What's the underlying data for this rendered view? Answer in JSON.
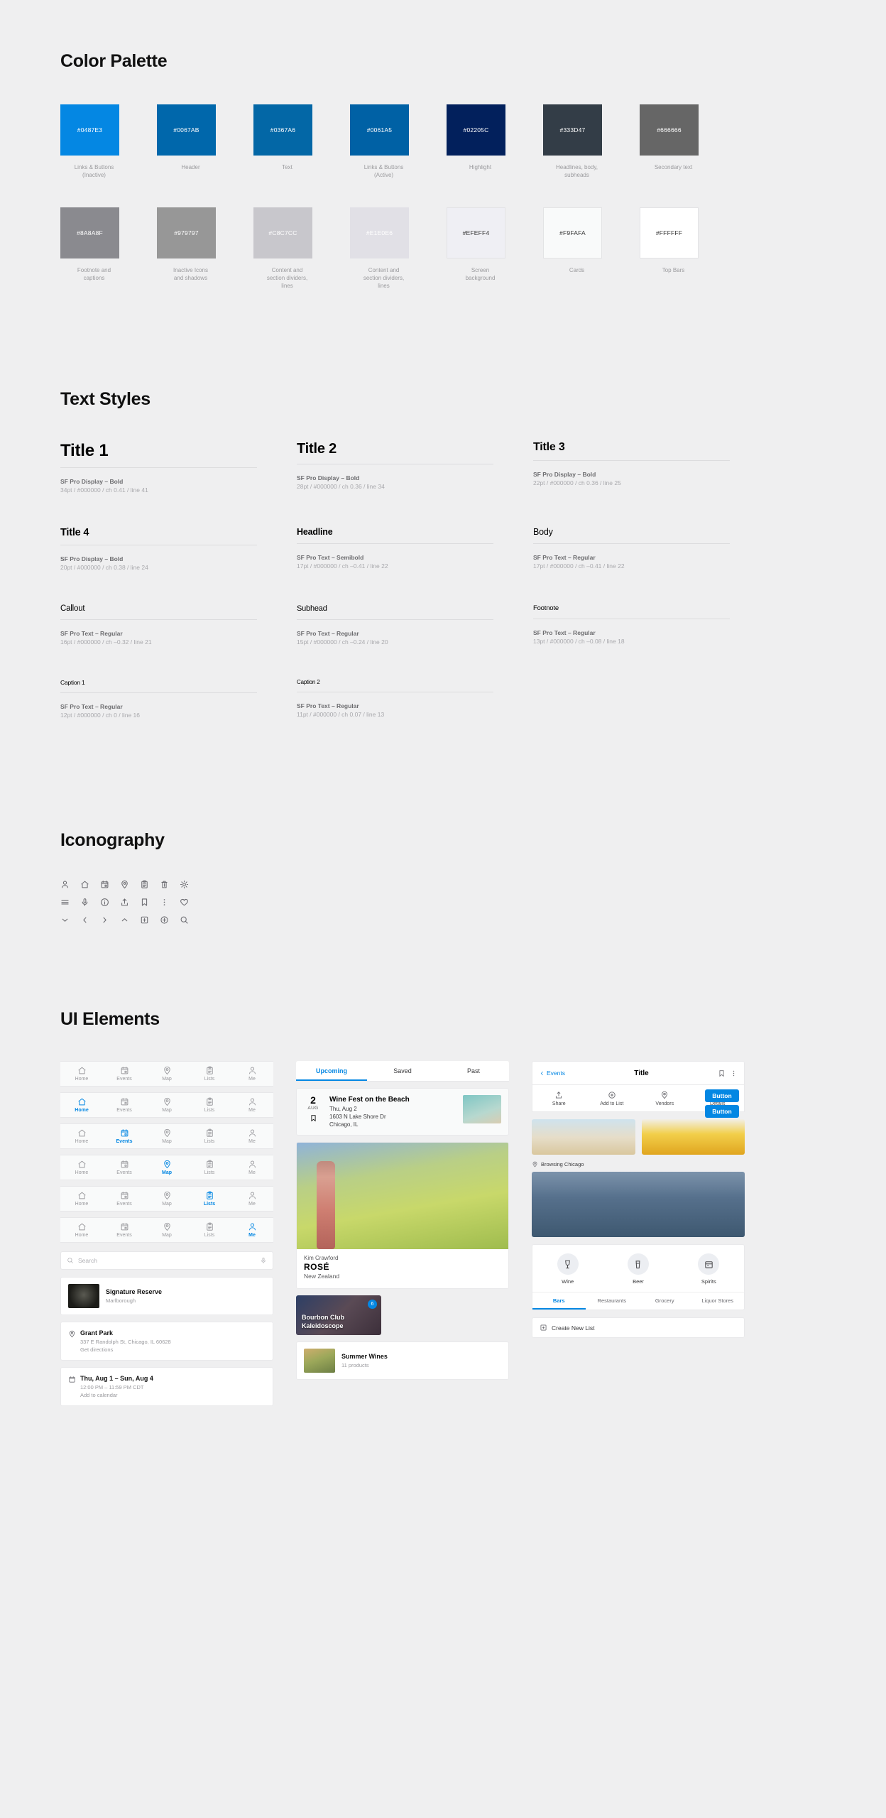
{
  "sections": {
    "colors": "Color Palette",
    "text": "Text Styles",
    "icons": "Iconography",
    "ui": "UI Elements"
  },
  "palette": [
    {
      "hex": "#0487E3",
      "label": "Links & Buttons\n(Inactive)",
      "text": "light"
    },
    {
      "hex": "#0067AB",
      "label": "Header",
      "text": "light"
    },
    {
      "hex": "#0367A6",
      "label": "Text",
      "text": "light"
    },
    {
      "hex": "#0061A5",
      "label": "Links & Buttons\n(Active)",
      "text": "light"
    },
    {
      "hex": "#02205C",
      "label": "Highlight",
      "text": "light"
    },
    {
      "hex": "#333D47",
      "label": "Headlines, body,\nsubheads",
      "text": "light"
    },
    {
      "hex": "#666666",
      "label": "Secondary text",
      "text": "light"
    },
    {
      "hex": "#8A8A8F",
      "label": "Footnote and\ncaptions",
      "text": "light"
    },
    {
      "hex": "#979797",
      "label": "Inactive Icons\nand shadows",
      "text": "light"
    },
    {
      "hex": "#C8C7CC",
      "label": "Content and\nsection dividers,\nlines",
      "text": "light"
    },
    {
      "hex": "#E1E0E6",
      "label": "Content and\nsection dividers,\nlines",
      "text": "light"
    },
    {
      "hex": "#EFEFF4",
      "label": "Screen\nbackground",
      "text": "dark"
    },
    {
      "hex": "#F9FAFA",
      "label": "Cards",
      "text": "dark"
    },
    {
      "hex": "#FFFFFF",
      "label": "Top Bars",
      "text": "dark"
    }
  ],
  "text_styles": [
    {
      "sample": "Title 1",
      "size_class": "t-34",
      "font": "SF Pro Display – Bold",
      "spec": "34pt / #000000 / ch 0.41 / line 41"
    },
    {
      "sample": "Title 2",
      "size_class": "t-28",
      "font": "SF Pro Display – Bold",
      "spec": "28pt / #000000 / ch 0.36 / line 34"
    },
    {
      "sample": "Title 3",
      "size_class": "t-22",
      "font": "SF Pro Display – Bold",
      "spec": "22pt / #000000 / ch 0.36 / line 25"
    },
    {
      "sample": "Title 4",
      "size_class": "t-20",
      "font": "SF Pro Display – Bold",
      "spec": "20pt / #000000 / ch 0.38 / line 24"
    },
    {
      "sample": "Headline",
      "size_class": "t-17b",
      "font": "SF Pro Text – Semibold",
      "spec": "17pt / #000000 / ch –0.41 / line 22"
    },
    {
      "sample": "Body",
      "size_class": "t-17r",
      "font": "SF Pro Text – Regular",
      "spec": "17pt / #000000 / ch –0.41 / line 22"
    },
    {
      "sample": "Callout",
      "size_class": "t-16",
      "font": "SF Pro Text – Regular",
      "spec": "16pt / #000000 / ch –0.32 / line 21"
    },
    {
      "sample": "Subhead",
      "size_class": "t-15",
      "font": "SF Pro Text – Regular",
      "spec": "15pt / #000000 / ch –0.24 / line 20"
    },
    {
      "sample": "Footnote",
      "size_class": "t-13",
      "font": "SF Pro Text – Regular",
      "spec": "13pt / #000000 / ch –0.08 / line 18"
    },
    {
      "sample": "Caption 1",
      "size_class": "t-12",
      "font": "SF Pro Text – Regular",
      "spec": "12pt / #000000 / ch 0 / line 16"
    },
    {
      "sample": "Caption 2",
      "size_class": "t-11",
      "font": "SF Pro Text – Regular",
      "spec": "11pt / #000000 / ch 0.07 / line 13"
    }
  ],
  "icons": {
    "row1": [
      "person-icon",
      "home-icon",
      "calendar-icon",
      "map-pin-icon",
      "clipboard-icon",
      "trash-icon",
      "gear-icon"
    ],
    "row2": [
      "menu-icon",
      "microphone-icon",
      "info-icon",
      "upload-icon",
      "bookmark-icon",
      "more-vertical-icon",
      "heart-icon"
    ],
    "row3": [
      "chevron-down-icon",
      "chevron-left-icon",
      "chevron-right-icon",
      "chevron-up-icon",
      "plus-square-icon",
      "plus-circle-icon",
      "search-icon"
    ]
  },
  "tabbar": {
    "items": [
      "Home",
      "Events",
      "Map",
      "Lists",
      "Me"
    ],
    "active_states": [
      -1,
      0,
      1,
      2,
      3,
      4
    ]
  },
  "search": {
    "placeholder": "Search"
  },
  "list_items": [
    {
      "title": "Signature Reserve",
      "sub": "Marlborough"
    },
    {
      "title": "Grant Park",
      "sub": "337 E Randolph St, Chicago, IL 60628",
      "sub2": "Get directions"
    },
    {
      "title": "Thu, Aug 1 – Sun, Aug 4",
      "sub": "12:00 PM – 11:59 PM CDT",
      "sub2": "Add to calendar"
    }
  ],
  "segmented": {
    "tabs": [
      "Upcoming",
      "Saved",
      "Past"
    ],
    "active": 0
  },
  "event": {
    "day": "2",
    "month": "AUG",
    "title": "Wine Fest on the Beach",
    "date": "Thu, Aug 2",
    "address": "1603 N Lake Shore Dr",
    "city": "Chicago, IL"
  },
  "wine": {
    "brand": "Kim Crawford",
    "name": "ROSÉ",
    "origin": "New Zealand"
  },
  "promos": [
    {
      "title": "Bourbon Club\nKaleidoscope",
      "badge": "6"
    },
    {
      "title": "Summer Wines",
      "sub": "11 products"
    }
  ],
  "detail": {
    "back": "Events",
    "title": "Title",
    "actions": [
      "Share",
      "Add to List",
      "Vendors",
      "Details"
    ],
    "buttons": [
      "Button",
      "Button"
    ],
    "location": "Browsing Chicago",
    "categories": [
      "Wine",
      "Beer",
      "Spirits"
    ],
    "subtabs": [
      "Bars",
      "Restaurants",
      "Grocery",
      "Liquor Stores"
    ],
    "subtabs_active": 0,
    "create_list": "Create New List"
  }
}
